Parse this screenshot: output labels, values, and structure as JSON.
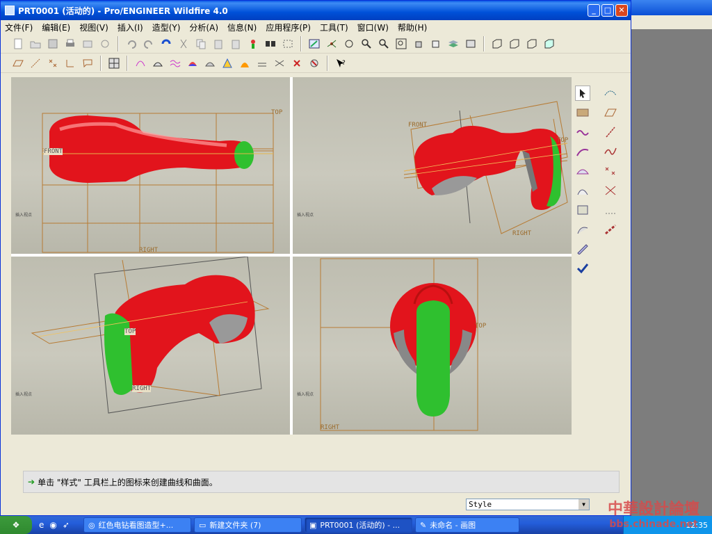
{
  "window": {
    "title": "PRT0001 (活动的) - Pro/ENGINEER Wildfire 4.0"
  },
  "menu": [
    "文件(F)",
    "编辑(E)",
    "视图(V)",
    "插入(I)",
    "造型(Y)",
    "分析(A)",
    "信息(N)",
    "应用程序(P)",
    "工具(T)",
    "窗口(W)",
    "帮助(H)"
  ],
  "viewports": {
    "tl": {
      "labels": [
        "TOP",
        "FRONT",
        "RIGHT"
      ],
      "corner": "插入视点"
    },
    "tr": {
      "labels": [
        "FRONT",
        "TOP",
        "RIGHT"
      ],
      "corner": "插入视点"
    },
    "bl": {
      "labels": [
        "TOP",
        "RIGHT"
      ],
      "corner": "插入视点"
    },
    "br": {
      "labels": [
        "TOP",
        "RIGHT"
      ],
      "corner": "插入视点"
    }
  },
  "message": "单击 \"样式\" 工具栏上的图标来创建曲线和曲面。",
  "style_dropdown": {
    "value": "Style"
  },
  "taskbar": {
    "items": [
      "红色电钻看图造型+...",
      "新建文件夹 (7)",
      "PRT0001 (活动的) - ...",
      "未命名 - 画图"
    ],
    "clock": "12:35"
  },
  "watermark": {
    "line1": "中華設計論壇",
    "line2": "bbs.chinade.net"
  },
  "colors": {
    "red": "#e2141c",
    "green": "#2fc02f",
    "datum": "#b77b34",
    "title": "#0a4fd6"
  }
}
